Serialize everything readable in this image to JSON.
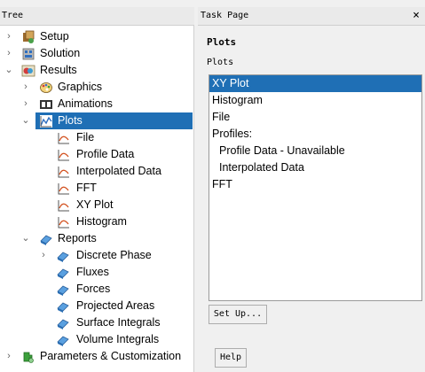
{
  "tree": {
    "title": "Tree",
    "items": [
      {
        "label": "Setup",
        "icon": "setup-icon"
      },
      {
        "label": "Solution",
        "icon": "solution-icon"
      },
      {
        "label": "Results",
        "icon": "results-icon"
      },
      {
        "label": "Graphics",
        "icon": "graphics-icon"
      },
      {
        "label": "Animations",
        "icon": "animations-icon"
      },
      {
        "label": "Plots",
        "icon": "plots-icon"
      },
      {
        "label": "File",
        "icon": "plot-curve-icon"
      },
      {
        "label": "Profile Data",
        "icon": "plot-curve-icon"
      },
      {
        "label": "Interpolated Data",
        "icon": "plot-curve-icon"
      },
      {
        "label": "FFT",
        "icon": "plot-curve-icon"
      },
      {
        "label": "XY Plot",
        "icon": "plot-curve-icon"
      },
      {
        "label": "Histogram",
        "icon": "plot-curve-icon"
      },
      {
        "label": "Reports",
        "icon": "reports-icon"
      },
      {
        "label": "Discrete Phase",
        "icon": "report-item-icon"
      },
      {
        "label": "Fluxes",
        "icon": "report-item-icon"
      },
      {
        "label": "Forces",
        "icon": "report-item-icon"
      },
      {
        "label": "Projected Areas",
        "icon": "report-item-icon"
      },
      {
        "label": "Surface Integrals",
        "icon": "report-item-icon"
      },
      {
        "label": "Volume Integrals",
        "icon": "report-item-icon"
      },
      {
        "label": "Parameters & Customization",
        "icon": "parameters-icon"
      }
    ]
  },
  "task": {
    "header": "Task Page",
    "close": "×",
    "title": "Plots",
    "subtitle": "Plots",
    "list": [
      {
        "label": "XY Plot",
        "selected": true
      },
      {
        "label": "Histogram"
      },
      {
        "label": "File"
      },
      {
        "label": "Profiles:"
      },
      {
        "label": "Profile Data - Unavailable",
        "indent": true
      },
      {
        "label": "Interpolated Data",
        "indent": true
      },
      {
        "label": "FFT"
      }
    ],
    "setup_button": "Set Up...",
    "help_button": "Help"
  },
  "colors": {
    "selection": "#1f6fb5",
    "panel_bg": "#f0f0f0"
  }
}
